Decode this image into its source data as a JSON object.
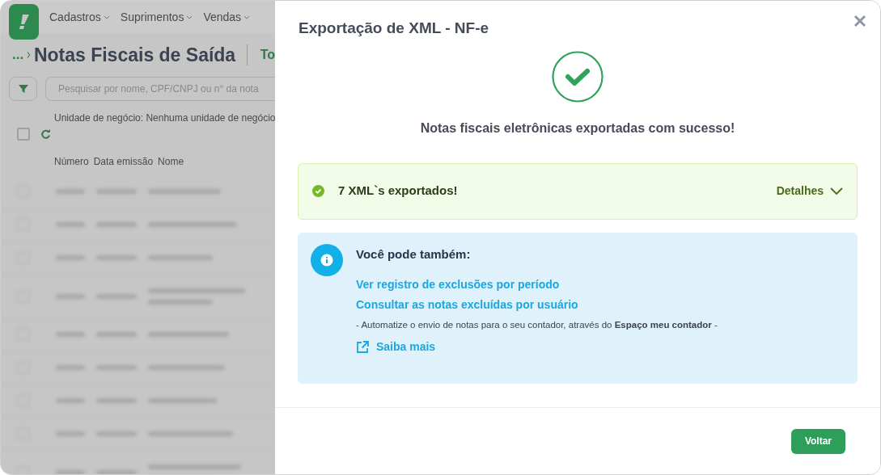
{
  "background_page": {
    "menu": [
      "Cadastros",
      "Suprimentos",
      "Vendas"
    ],
    "breadcrumb": "...",
    "title": "Notas Fiscais de Saída",
    "tab_partial": "To",
    "search": {
      "placeholder": "Pesquisar por nome, CPF/CNPJ ou n° da nota"
    },
    "business_unit": "Unidade de negócio: Nenhuma unidade de negócio",
    "select_all": {
      "checked": false
    },
    "columns": [
      "Número",
      "Data emissão",
      "Nome"
    ],
    "rows": [
      {
        "kind": "single"
      },
      {
        "kind": "single"
      },
      {
        "kind": "single"
      },
      {
        "kind": "double"
      },
      {
        "kind": "single"
      },
      {
        "kind": "single"
      },
      {
        "kind": "single"
      },
      {
        "kind": "single"
      },
      {
        "kind": "double"
      }
    ]
  },
  "modal": {
    "title": "Exportação de XML - NF-e",
    "message": "Notas fiscais eletrônicas exportadas com sucesso!",
    "result": {
      "text": "7 XML`s exportados!",
      "details": "Detalhes",
      "expanded": false
    },
    "info": {
      "heading": "Você pode também:",
      "links": [
        "Ver registro de exclusões por período",
        "Consultar as notas excluídas por usuário"
      ],
      "note": "- Automatize o envio de notas para o seu contador, através do **Espaço meu contador** -",
      "more": "Saiba mais"
    },
    "button": "Voltar"
  }
}
